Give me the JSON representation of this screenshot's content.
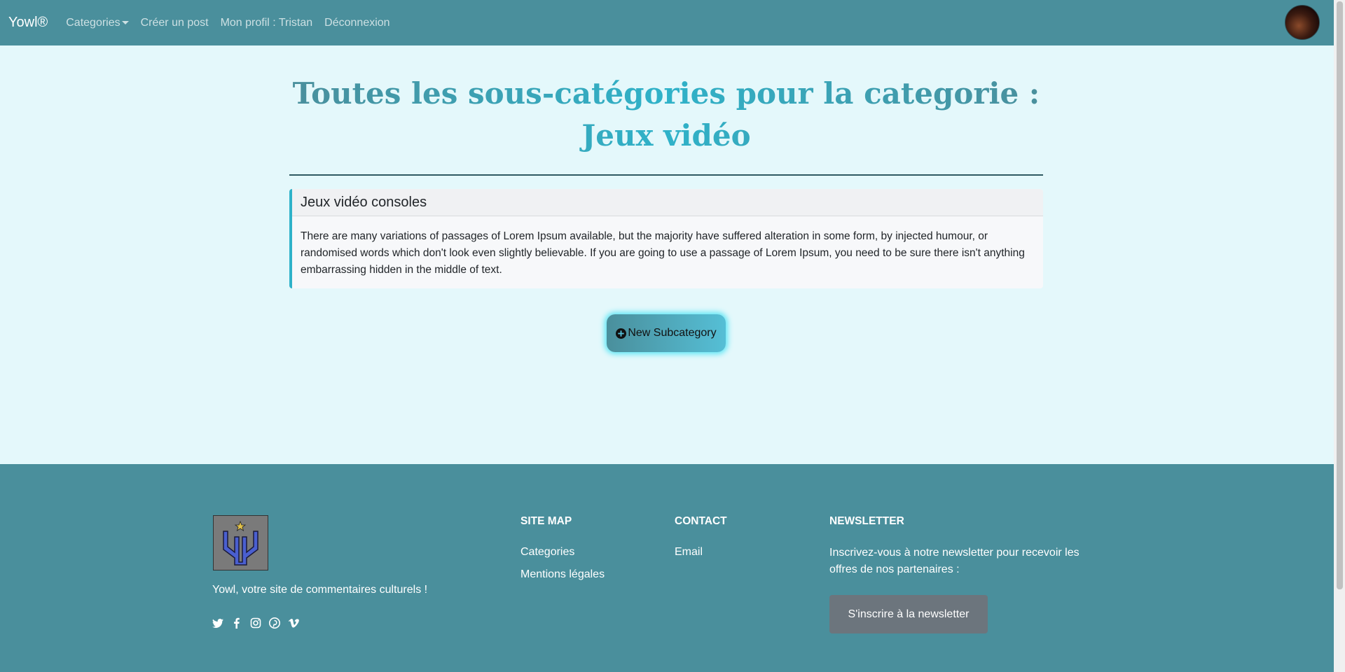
{
  "navbar": {
    "brand": "Yowl®",
    "links": {
      "categories": "Categories",
      "create_post": "Créer un post",
      "profile": "Mon profil : Tristan",
      "logout": "Déconnexion"
    }
  },
  "main": {
    "title": "Toutes les sous-catégories pour la categorie : Jeux vidéo",
    "subcategories": [
      {
        "title": "Jeux vidéo consoles",
        "description": "There are many variations of passages of Lorem Ipsum available, but the majority have suffered alteration in some form, by injected humour, or randomised words which don't look even slightly believable. If you are going to use a passage of Lorem Ipsum, you need to be sure there isn't anything embarrassing hidden in the middle of text."
      }
    ],
    "new_button_label": "New Subcategory"
  },
  "footer": {
    "tagline": "Yowl, votre site de commentaires culturels !",
    "social_icons": [
      "twitter-icon",
      "facebook-icon",
      "instagram-icon",
      "pinterest-icon",
      "vimeo-icon"
    ],
    "sitemap": {
      "heading": "SITE MAP",
      "links": [
        "Categories",
        "Mentions légales"
      ]
    },
    "contact": {
      "heading": "CONTACT",
      "links": [
        "Email"
      ]
    },
    "newsletter": {
      "heading": "NEWSLETTER",
      "text": "Inscrivez-vous à notre newsletter pour recevoir les offres de nos partenaires :",
      "button_label": "S'inscrire à la newsletter"
    }
  },
  "colors": {
    "navbar_bg": "#4a8f9c",
    "page_bg": "#e4f8fb",
    "accent": "#2fb2c9",
    "button_glow": "#5ee6f5",
    "newsletter_button": "#6c757d"
  }
}
